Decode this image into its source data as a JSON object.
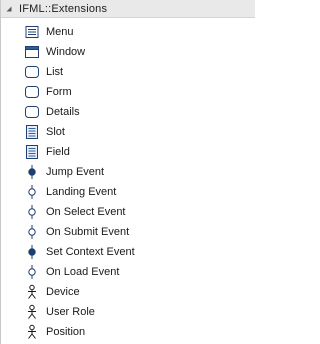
{
  "toolbox": {
    "title": "IFML::Extensions",
    "items": [
      {
        "label": "Menu",
        "icon": "menu-icon"
      },
      {
        "label": "Window",
        "icon": "window-icon"
      },
      {
        "label": "List",
        "icon": "list-icon"
      },
      {
        "label": "Form",
        "icon": "form-icon"
      },
      {
        "label": "Details",
        "icon": "details-icon"
      },
      {
        "label": "Slot",
        "icon": "slot-icon"
      },
      {
        "label": "Field",
        "icon": "field-icon"
      },
      {
        "label": "Jump Event",
        "icon": "jump-event-icon"
      },
      {
        "label": "Landing Event",
        "icon": "landing-event-icon"
      },
      {
        "label": "On Select Event",
        "icon": "on-select-event-icon"
      },
      {
        "label": "On Submit Event",
        "icon": "on-submit-event-icon"
      },
      {
        "label": "Set Context Event",
        "icon": "set-context-event-icon"
      },
      {
        "label": "On Load Event",
        "icon": "on-load-event-icon"
      },
      {
        "label": "Device",
        "icon": "device-icon"
      },
      {
        "label": "User Role",
        "icon": "user-role-icon"
      },
      {
        "label": "Position",
        "icon": "position-icon"
      }
    ]
  }
}
